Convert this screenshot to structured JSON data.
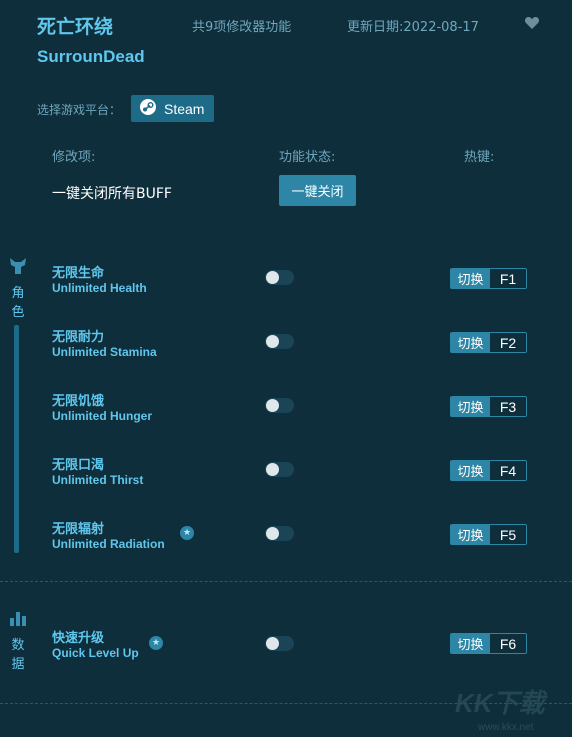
{
  "header": {
    "title_cn": "死亡环绕",
    "title_en": "SurrounDead",
    "feature_count": "共9项修改器功能",
    "update_date": "更新日期:2022-08-17",
    "favorite_icon": "heart-icon"
  },
  "platform": {
    "label": "选择游戏平台：",
    "button": "Steam",
    "icon": "steam-icon"
  },
  "columns": {
    "option": "修改项:",
    "status": "功能状态:",
    "hotkey": "热键:"
  },
  "all_buff": {
    "label": "一键关闭所有BUFF",
    "button": "一键关闭"
  },
  "categories": [
    {
      "name": "角色",
      "icon": "character-icon",
      "options": [
        {
          "cn": "无限生命",
          "en": "Unlimited Health",
          "hotkey_label": "切换",
          "key": "F1",
          "star": false,
          "enabled": false
        },
        {
          "cn": "无限耐力",
          "en": "Unlimited Stamina",
          "hotkey_label": "切换",
          "key": "F2",
          "star": false,
          "enabled": false
        },
        {
          "cn": "无限饥饿",
          "en": "Unlimited Hunger",
          "hotkey_label": "切换",
          "key": "F3",
          "star": false,
          "enabled": false
        },
        {
          "cn": "无限口渴",
          "en": "Unlimited Thirst",
          "hotkey_label": "切换",
          "key": "F4",
          "star": false,
          "enabled": false
        },
        {
          "cn": "无限辐射",
          "en": "Unlimited Radiation",
          "hotkey_label": "切换",
          "key": "F5",
          "star": true,
          "enabled": false
        }
      ]
    },
    {
      "name": "数据",
      "icon": "data-bars-icon",
      "options": [
        {
          "cn": "快速升级",
          "en": "Quick Level Up",
          "hotkey_label": "切换",
          "key": "F6",
          "star": true,
          "enabled": false
        }
      ]
    }
  ],
  "watermark": {
    "logo": "KK下载",
    "url": "www.kkx.net"
  },
  "colors": {
    "background": "#0f2e3b",
    "accent": "#5fc7ee",
    "button": "#2e86a6"
  }
}
